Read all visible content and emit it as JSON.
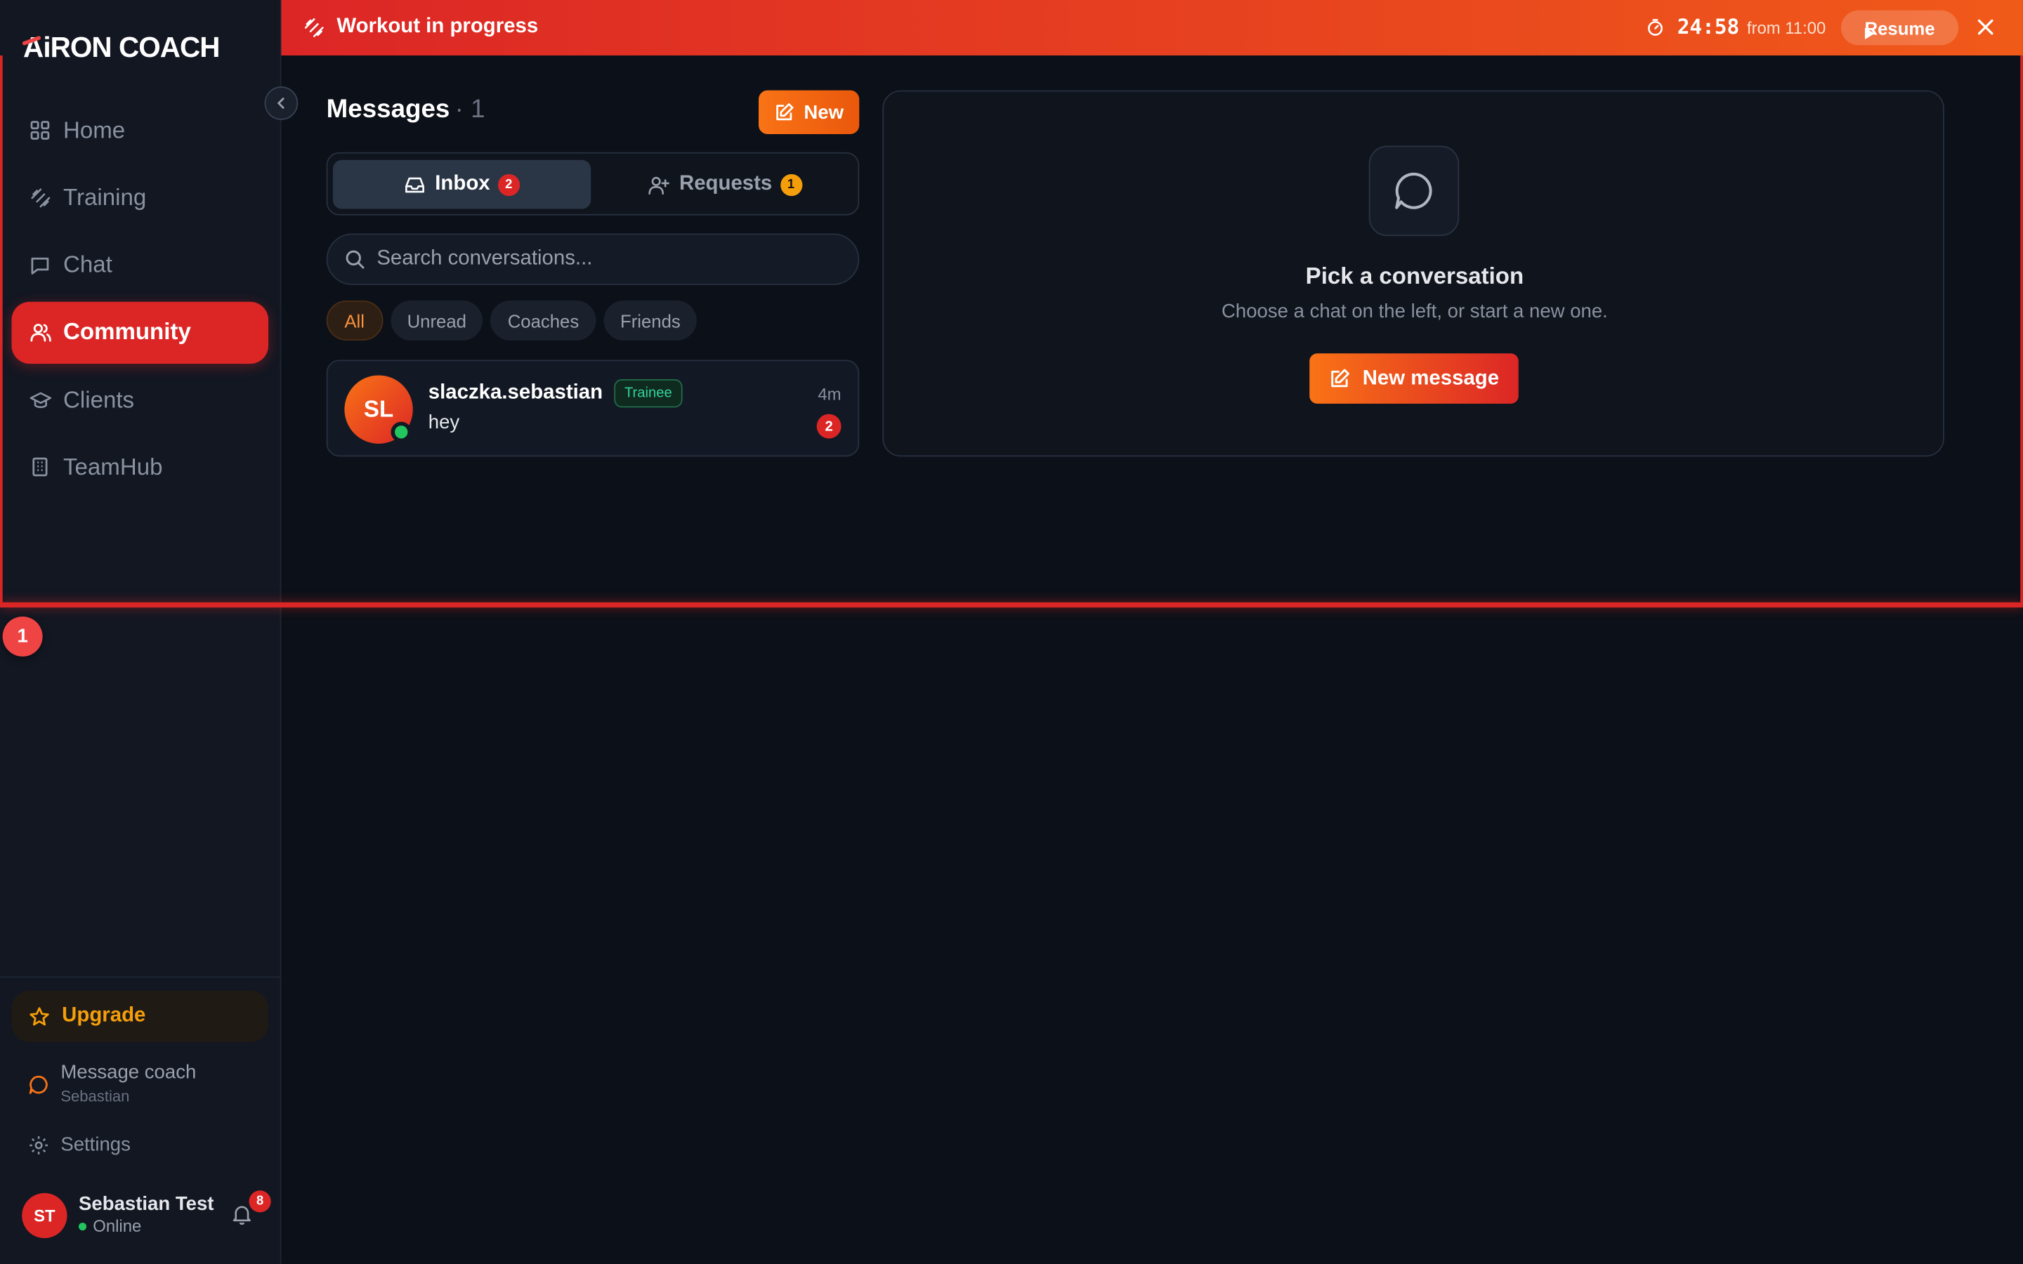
{
  "app": {
    "logo": "AiRON COACH",
    "logo_a": "A",
    "logo_rest": "iRON COACH"
  },
  "colors": {
    "accent": "#dc2626",
    "orange": "#f97316",
    "amber": "#f59e0b",
    "online": "#22c55e",
    "background": "#0c1018"
  },
  "sidebar": {
    "items": [
      {
        "label": "Home",
        "icon": "grid-icon",
        "active": false
      },
      {
        "label": "Training",
        "icon": "dumbbell-icon",
        "active": false
      },
      {
        "label": "Chat",
        "icon": "chat-bubble-icon",
        "active": false
      },
      {
        "label": "Community",
        "icon": "users-icon",
        "active": true
      },
      {
        "label": "Clients",
        "icon": "graduation-cap-icon",
        "active": false
      },
      {
        "label": "TeamHub",
        "icon": "building-icon",
        "active": false
      }
    ],
    "upgrade": "Upgrade",
    "message_coach": {
      "label": "Message coach",
      "coach_name": "Sebastian"
    },
    "settings": "Settings",
    "user": {
      "initials": "ST",
      "name": "Sebastian Test",
      "status": "Online",
      "notifications": "8"
    }
  },
  "banner": {
    "title": "Workout in progress",
    "timer": "24:58",
    "from": "from 11:00",
    "resume": "Resume"
  },
  "frame_badge": "1",
  "messages": {
    "title": "Messages",
    "count": "· 1",
    "new_button": "New",
    "tabs": [
      {
        "label": "Inbox",
        "badge": "2",
        "icon": "inbox-icon"
      },
      {
        "label": "Requests",
        "badge": "1",
        "icon": "user-plus-icon"
      }
    ],
    "search_placeholder": "Search conversations...",
    "filters": [
      "All",
      "Unread",
      "Coaches",
      "Friends"
    ],
    "active_filter": "All",
    "conversations": [
      {
        "initials": "SL",
        "name": "slaczka.sebastian",
        "tag": "Trainee",
        "last_message": "hey",
        "time": "4m",
        "unread": "2",
        "online": true
      }
    ]
  },
  "empty_state": {
    "title": "Pick a conversation",
    "subtitle": "Choose a chat on the left, or start a new one.",
    "button": "New message"
  }
}
